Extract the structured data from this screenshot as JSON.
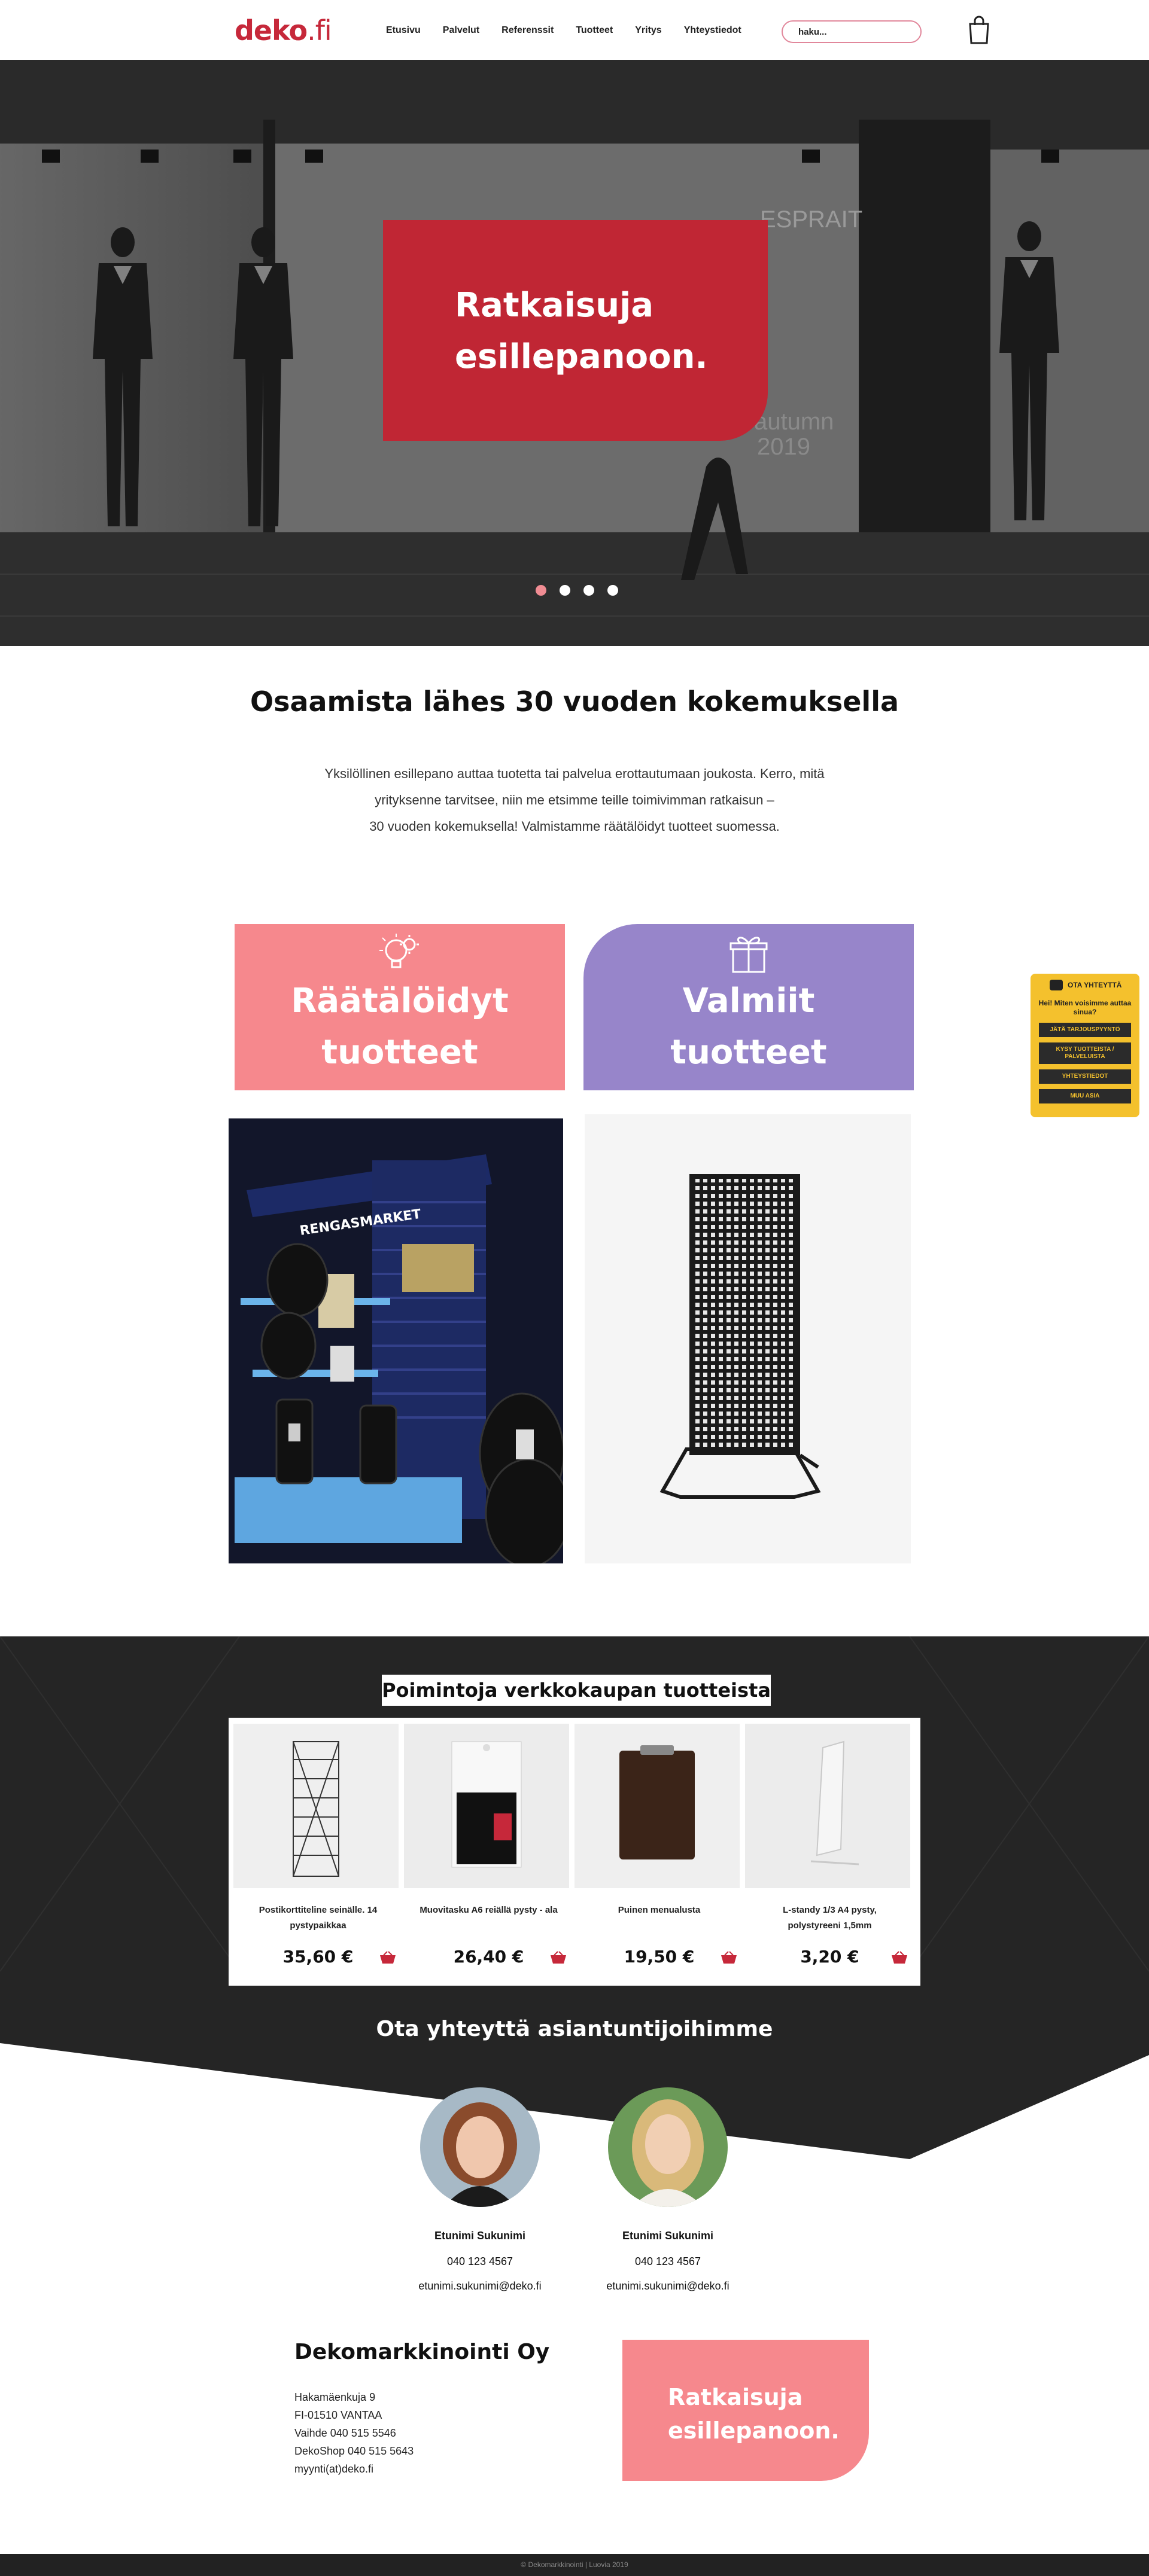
{
  "brand": {
    "logo_main": "deko",
    "logo_tld": ".fi",
    "accent": "#c02634",
    "pink": "#f6888d",
    "purple": "#9785ca",
    "dark": "#252525",
    "yellow": "#f4c12d"
  },
  "nav": {
    "items": [
      "Etusivu",
      "Palvelut",
      "Referenssit",
      "Tuotteet",
      "Yritys",
      "Yhteystiedot"
    ],
    "search_placeholder": "haku...",
    "cart_icon": "shopping-bag-icon"
  },
  "hero": {
    "headline_line1": "Ratkaisuja",
    "headline_line2": "esillepanoon.",
    "window_text_1": "ESPRAIT",
    "window_text_2": "autumn",
    "window_text_3": "2019",
    "slides": 4,
    "active_slide": 1
  },
  "intro": {
    "title": "Osaamista lähes 30 vuoden kokemuksella",
    "line1": "Yksilöllinen esillepano auttaa tuotetta tai palvelua erottautumaan joukosta. Kerro, mitä",
    "line2": "yrityksenne tarvitsee, niin me etsimme teille toimivimman ratkaisun –",
    "line3": "30 vuoden kokemuksella! Valmistamme räätälöidyt tuotteet suomessa."
  },
  "tiles": [
    {
      "line1": "Räätälöidyt",
      "line2": "tuotteet",
      "icon": "lightbulb-gear-icon"
    },
    {
      "line1": "Valmiit",
      "line2": "tuotteet",
      "icon": "gift-icon"
    }
  ],
  "photo_a_sign": "RENGASMARKET",
  "chat": {
    "title": "OTA YHTEYTTÄ",
    "message": "Hei! Miten voisimme auttaa sinua?",
    "buttons": [
      "JÄTÄ TARJOUSPYYNTÖ",
      "KYSY TUOTTEISTA / PALVELUISTA",
      "YHTEYSTIEDOT",
      "MUU ASIA"
    ]
  },
  "shop": {
    "title": "Poimintoja verkkokaupan tuotteista",
    "products": [
      {
        "name": "Postikorttiteline seinälle. 14 pystypaikkaa",
        "price": "35,60 €"
      },
      {
        "name": "Muovitasku A6 reiällä pysty - ala",
        "price": "26,40 €"
      },
      {
        "name": "Puinen menualusta",
        "price": "19,50 €"
      },
      {
        "name": "L-standy 1/3 A4 pysty, polystyreeni 1,5mm",
        "price": "3,20 €"
      }
    ]
  },
  "contacts": {
    "title": "Ota yhteyttä asiantuntijoihimme",
    "people": [
      {
        "name": "Etunimi Sukunimi",
        "phone": "040 123 4567",
        "email": "etunimi.sukunimi@deko.fi"
      },
      {
        "name": "Etunimi Sukunimi",
        "phone": "040 123 4567",
        "email": "etunimi.sukunimi@deko.fi"
      }
    ]
  },
  "company": {
    "name": "Dekomarkkinointi Oy",
    "street": "Hakamäenkuja 9",
    "city": "FI-01510 VANTAA",
    "phone1": "Vaihde 040 515 5546",
    "phone2": "DekoShop  040 515 5643",
    "email": "myynti(at)deko.fi",
    "promo_line1": "Ratkaisuja",
    "promo_line2": "esillepanoon."
  },
  "footer": {
    "copyright": "© Dekomarkkinointi | Luovia 2019"
  }
}
